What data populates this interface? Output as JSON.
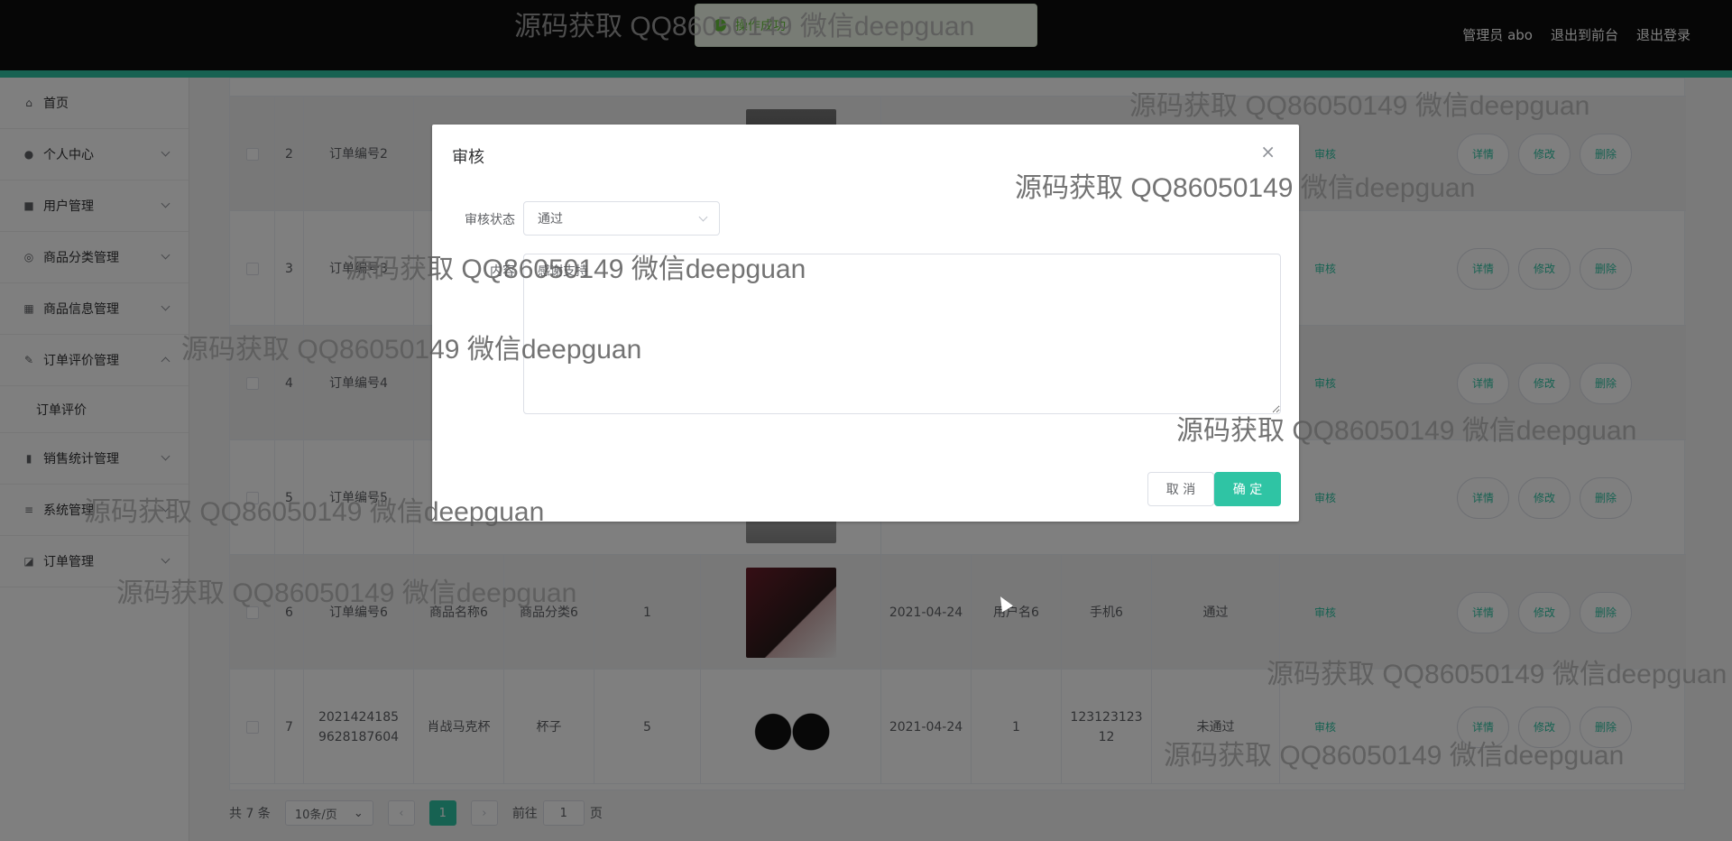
{
  "header": {
    "site_title": "",
    "admin_label": "管理员 abo",
    "to_front": "退出到前台",
    "logout": "退出登录"
  },
  "toast": {
    "message": "操作成功"
  },
  "sidebar": {
    "items": [
      {
        "label": "首页",
        "icon": "home-icon"
      },
      {
        "label": "个人中心",
        "icon": "user-icon"
      },
      {
        "label": "用户管理",
        "icon": "chat-icon"
      },
      {
        "label": "商品分类管理",
        "icon": "compass-icon"
      },
      {
        "label": "商品信息管理",
        "icon": "shop-icon"
      },
      {
        "label": "订单评价管理",
        "icon": "edit-icon"
      },
      {
        "label": "订单评价",
        "icon": ""
      },
      {
        "label": "销售统计管理",
        "icon": "chart-icon"
      },
      {
        "label": "系统管理",
        "icon": "settings-icon"
      },
      {
        "label": "订单管理",
        "icon": "tag-icon"
      }
    ]
  },
  "table": {
    "rows": [
      {
        "index": "2",
        "order_no": "订单编号2",
        "name": "",
        "category": "",
        "qty": "",
        "date": "",
        "user": "",
        "phone": "",
        "status": "",
        "audit": "审核",
        "detail": "详情",
        "edit": "修改",
        "delete": "删除"
      },
      {
        "index": "3",
        "order_no": "订单编号3",
        "name": "",
        "category": "",
        "qty": "",
        "date": "",
        "user": "",
        "phone": "",
        "status": "",
        "audit": "审核",
        "detail": "详情",
        "edit": "修改",
        "delete": "删除"
      },
      {
        "index": "4",
        "order_no": "订单编号4",
        "name": "",
        "category": "",
        "qty": "",
        "date": "",
        "user": "",
        "phone": "",
        "status": "",
        "audit": "审核",
        "detail": "详情",
        "edit": "修改",
        "delete": "删除"
      },
      {
        "index": "5",
        "order_no": "订单编号5",
        "name": "",
        "category": "",
        "qty": "",
        "date": "",
        "user": "",
        "phone": "",
        "status": "",
        "audit": "审核",
        "detail": "详情",
        "edit": "修改",
        "delete": "删除"
      },
      {
        "index": "6",
        "order_no": "订单编号6",
        "name": "商品名称6",
        "category": "商品分类6",
        "qty": "1",
        "date": "2021-04-24",
        "user": "用户名6",
        "phone": "手机6",
        "status": "通过",
        "audit": "审核",
        "detail": "详情",
        "edit": "修改",
        "delete": "删除"
      },
      {
        "index": "7",
        "order_no": "2021424185 9628187604",
        "name": "肖战马克杯",
        "category": "杯子",
        "qty": "5",
        "date": "2021-04-24",
        "user": "1",
        "phone": "123123123 12",
        "status": "未通过",
        "audit": "审核",
        "detail": "详情",
        "edit": "修改",
        "delete": "删除"
      }
    ]
  },
  "pager": {
    "total": "共 7 条",
    "page_size": "10条/页",
    "current": "1",
    "goto_prefix": "前往",
    "goto_value": "1",
    "goto_suffix": "页"
  },
  "dialog": {
    "title": "审核",
    "status_label": "审核状态",
    "status_value": "通过",
    "content_label": "内容",
    "content_value": "感谢支持",
    "cancel": "取 消",
    "confirm": "确 定"
  },
  "watermark": "源码获取 QQ86050149 微信deepguan"
}
